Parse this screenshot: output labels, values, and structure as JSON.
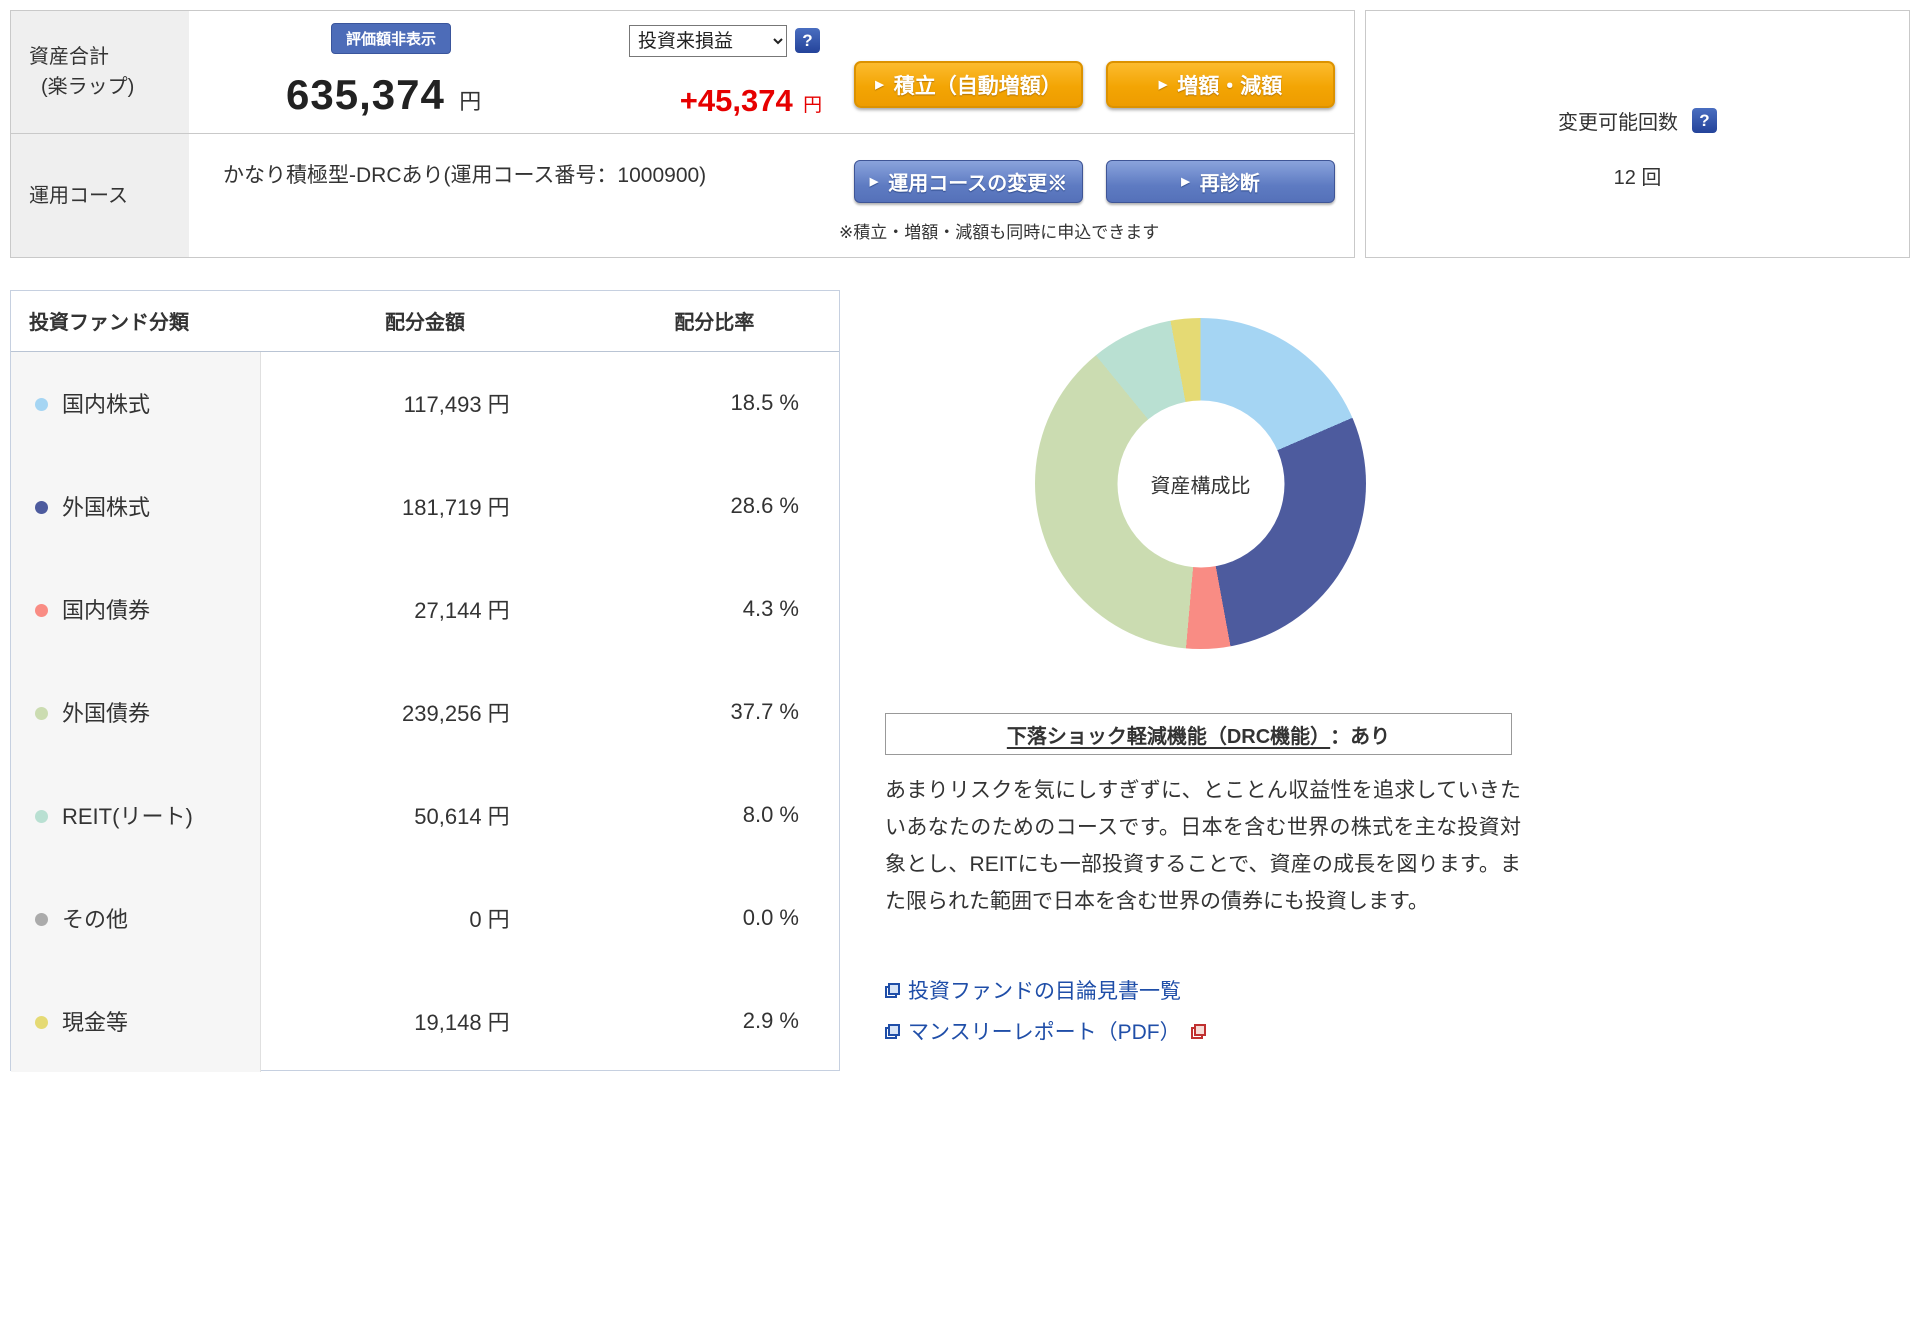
{
  "summary": {
    "asset_total_label_line1": "資産合計",
    "asset_total_label_line2": "(楽ラップ)",
    "hide_button": "評価額非表示",
    "total_amount": "635,374",
    "total_unit": "円",
    "pl_dropdown_value": "投資来損益",
    "pl_amount": "+45,374",
    "pl_unit": "円",
    "tsumitate_button": "積立（自動増額）",
    "zogaku_button": "増額・減額",
    "course_row_label": "運用コース",
    "course_name": "かなり積極型-DRCあり(運用コース番号：1000900)",
    "course_change_button": "運用コースの変更※",
    "rediagnose_button": "再診断",
    "note": "※積立・増額・減額も同時に申込できます",
    "change_limit_label": "変更可能回数",
    "change_limit_value": "12 回",
    "help_icon_glyph": "?",
    "button_marker": "▶"
  },
  "table": {
    "headers": [
      "投資ファンド分類",
      "配分金額",
      "配分比率"
    ],
    "rows": [
      {
        "label": "国内株式",
        "color": "#a5d5f3",
        "amount": "117,493 円",
        "ratio": "18.5 %"
      },
      {
        "label": "外国株式",
        "color": "#4d5b9e",
        "amount": "181,719 円",
        "ratio": "28.6 %"
      },
      {
        "label": "国内債券",
        "color": "#f98c84",
        "amount": "27,144 円",
        "ratio": "4.3 %"
      },
      {
        "label": "外国債券",
        "color": "#cbdcb1",
        "amount": "239,256 円",
        "ratio": "37.7 %"
      },
      {
        "label": "REIT(リート)",
        "color": "#b9e0d2",
        "amount": "50,614 円",
        "ratio": "8.0 %"
      },
      {
        "label": "その他",
        "color": "#ababab",
        "amount": "0 円",
        "ratio": "0.0 %"
      },
      {
        "label": "現金等",
        "color": "#e5da74",
        "amount": "19,148 円",
        "ratio": "2.9 %"
      }
    ]
  },
  "chart_data": {
    "type": "pie",
    "title": "資産構成比",
    "center_label": "資産構成比",
    "categories": [
      "国内株式",
      "外国株式",
      "国内債券",
      "外国債券",
      "REIT(リート)",
      "その他",
      "現金等"
    ],
    "values": [
      18.5,
      28.6,
      4.3,
      37.7,
      8.0,
      0.0,
      2.9
    ],
    "colors": [
      "#a5d5f3",
      "#4d5b9e",
      "#f98c84",
      "#cbdcb1",
      "#b9e0d2",
      "#ababab",
      "#e5da74"
    ],
    "legend_position": "none"
  },
  "drc": {
    "title_main": "下落ショック軽減機能（DRC機能）",
    "title_suffix": "：あり",
    "description": "あまりリスクを気にしすぎずに、とことん収益性を追求していきたいあなたのためのコースです。日本を含む世界の株式を主な投資対象とし、REITにも一部投資することで、資産の成長を図ります。また限られた範囲で日本を含む世界の債券にも投資します。",
    "link_prospectus": "投資ファンドの目論見書一覧",
    "link_monthly_report": "マンスリーレポート（PDF）"
  }
}
